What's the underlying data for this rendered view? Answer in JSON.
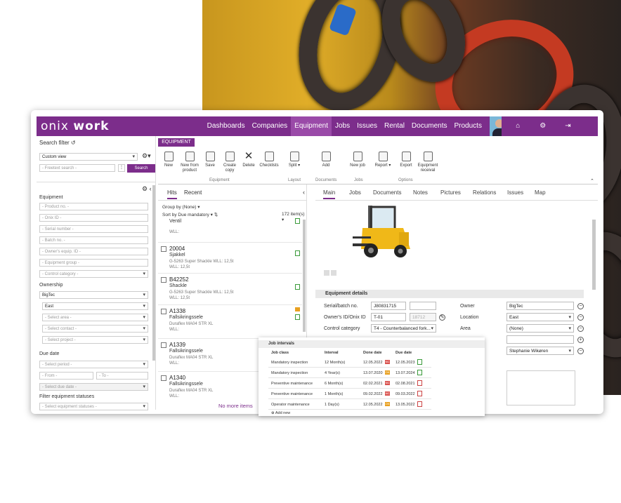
{
  "app": {
    "logo_left": "onix",
    "logo_right": "work",
    "signout": "Sign out"
  },
  "nav": [
    "Dashboards",
    "Companies",
    "Equipment",
    "Jobs",
    "Issues",
    "Rental",
    "Documents",
    "Products"
  ],
  "nav_active": "Equipment",
  "search": {
    "title": "Search filter",
    "view": "Custom view",
    "placeholder": "- Freetext search -",
    "button": "Search"
  },
  "filters": {
    "equipment_label": "Equipment",
    "equipment_fields": [
      "- Product no. -",
      "- Onix ID -",
      "- Serial number -",
      "- Batch no. -",
      "- Owner's equip. ID -",
      "- Equipment group -",
      "- Control category -"
    ],
    "ownership_label": "Ownership",
    "owner": "BigTec",
    "area": "East",
    "ownership_fields": [
      "- Select area -",
      "- Select contact -",
      "- Select project -"
    ],
    "due_label": "Due date",
    "period": "- Select period -",
    "from": "- From -",
    "to": "- To -",
    "due": "- Select due date -",
    "status_label": "Filter equipment statuses",
    "status": "- Select equipment statuses -"
  },
  "ribbon": {
    "tab": "EQUIPMENT",
    "tools": [
      "New",
      "New from product",
      "Save",
      "Create copy",
      "Delete",
      "Checklists",
      "Split",
      "Add",
      "New job",
      "Report",
      "Export",
      "Equipment receival"
    ],
    "groups": [
      "Equipment",
      "Layout",
      "Documents",
      "Jobs",
      "Options"
    ]
  },
  "hits": {
    "tab_hits": "Hits",
    "tab_recent": "Recent",
    "group_by": "Group by (None)",
    "sort": "Sort by Due mandatory",
    "count": "172 item(s)",
    "more": "No more items",
    "items": [
      {
        "id": "",
        "name": "Ventil",
        "desc": "",
        "wll": "WLL:"
      },
      {
        "id": "20004",
        "name": "Sjakkel",
        "desc": "G-5263 Super Shackle WLL: 12,5t",
        "wll": "WLL: 12,5t"
      },
      {
        "id": "B42252",
        "name": "Shackle",
        "desc": "G-5263 Super Shackle WLL: 12,5t",
        "wll": "WLL: 12,5t"
      },
      {
        "id": "A1338",
        "name": "Fallsikringssele",
        "desc": "Duraflex MA04 STR XL",
        "wll": "WLL:"
      },
      {
        "id": "A1339",
        "name": "Fallsikringssele",
        "desc": "Duraflex MA04 STR XL",
        "wll": "WLL:"
      },
      {
        "id": "A1340",
        "name": "Fallsikringssele",
        "desc": "Duraflex MA04 STR XL",
        "wll": "WLL:"
      }
    ]
  },
  "main": {
    "tabs": [
      "Main",
      "Jobs",
      "Documents",
      "Notes",
      "Pictures",
      "Relations",
      "Issues",
      "Map"
    ],
    "details_title": "Equipment details",
    "serial_label": "Serial/batch no.",
    "serial": "J80831715",
    "ownerid_label": "Owner's ID/Onix ID",
    "ownerid": "T-01",
    "onixid": "18712",
    "category_label": "Control category",
    "category": "T4 - Counterbalanced fork...",
    "owner_label": "Owner",
    "owner": "BigTec",
    "location_label": "Location",
    "location": "East",
    "area_label": "Area",
    "area": "(None)",
    "contact": "Stephanie Wikøren"
  },
  "jobs": {
    "title": "Job intervals",
    "headers": [
      "Job class",
      "Interval",
      "Done date",
      "Due date"
    ],
    "add": "Add new",
    "rows": [
      {
        "cls": "Mandatory inspection",
        "int": "12 Month(s)",
        "done": "12.05.2022",
        "due": "12.05.2023",
        "tag": "NC"
      },
      {
        "cls": "Mandatory inspection",
        "int": "4 Year(s)",
        "done": "13.07.2020",
        "due": "13.07.2024",
        "tag": "OK"
      },
      {
        "cls": "Preventive maintenance",
        "int": "6 Month(s)",
        "done": "02.02.2021",
        "due": "02.08.2021",
        "tag": "NC"
      },
      {
        "cls": "Preventive maintenance",
        "int": "1 Month(s)",
        "done": "09.02.2022",
        "due": "09.03.2022",
        "tag": "NC"
      },
      {
        "cls": "Operator maintenance",
        "int": "1 Day(s)",
        "done": "12.05.2022",
        "due": "13.05.2022",
        "tag": "OK"
      }
    ]
  },
  "colors": {
    "brand": "#7c2d8b",
    "nc": "#d9534f",
    "ok": "#e8a020"
  }
}
